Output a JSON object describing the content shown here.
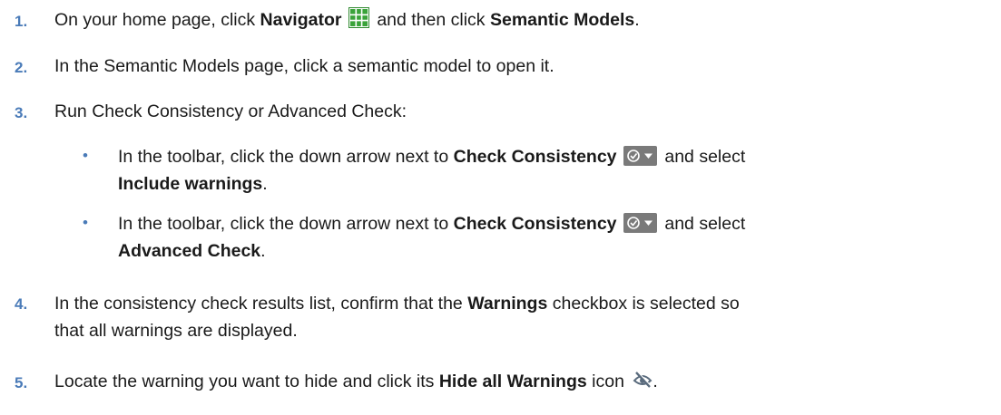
{
  "steps": [
    {
      "number": "1.",
      "parts": [
        "On your home page, click ",
        "Navigator",
        " and then click ",
        "Semantic Models",
        "."
      ]
    },
    {
      "number": "2.",
      "text": "In the Semantic Models page, click a semantic model to open it."
    },
    {
      "number": "3.",
      "text": "Run Check Consistency or Advanced Check:",
      "bullets": [
        {
          "marker": "•",
          "parts": [
            "In the toolbar, click the down arrow next to ",
            "Check Consistency",
            " and select",
            "Include warnings",
            "."
          ]
        },
        {
          "marker": "•",
          "parts": [
            "In the toolbar, click the down arrow next to ",
            "Check Consistency",
            " and select",
            "Advanced Check",
            "."
          ]
        }
      ]
    },
    {
      "number": "4.",
      "parts": [
        "In the consistency check results list, confirm that the ",
        "Warnings",
        " checkbox is selected so",
        "that all warnings are displayed."
      ]
    },
    {
      "number": "5.",
      "parts": [
        "Locate the warning you want to hide and click its ",
        "Hide all Warnings",
        " icon",
        "."
      ]
    }
  ],
  "icons": {
    "navigator": "navigator-grid-icon",
    "check_consistency": "check-consistency-dropdown-icon",
    "hide_warnings": "hide-warnings-icon"
  },
  "colors": {
    "number": "#4a7bb8",
    "navigator_icon": "#2f8a2f",
    "check_icon_bg": "#7a7a7a"
  }
}
